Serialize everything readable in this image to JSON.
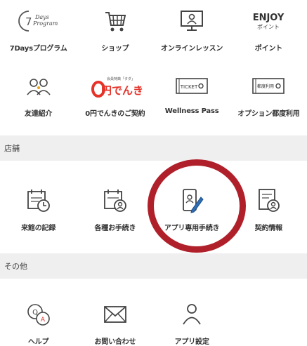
{
  "colors": {
    "accent": "#e5332a",
    "ring": "#b0202a",
    "section_bg": "#efefef",
    "text": "#333333"
  },
  "top_row": [
    {
      "label": "7Daysプログラム",
      "icon": "7days-program-logo",
      "logo_num": "7",
      "logo_l1": "Days",
      "logo_l2": "Program"
    },
    {
      "label": "ショップ",
      "icon": "shopping-cart-icon"
    },
    {
      "label": "オンラインレッスン",
      "icon": "monitor-person-icon"
    },
    {
      "label": "ポイント",
      "icon": "enjoy-point-logo",
      "logo_title": "ENJOY",
      "logo_sub": "ポイント"
    }
  ],
  "second_row": [
    {
      "label": "友達紹介",
      "icon": "two-people-icon"
    },
    {
      "label": "0円でんきのご契約",
      "icon": "zero-yen-denki-logo",
      "logo_small": "会員特典「タダ」",
      "logo_big": "円でんき"
    },
    {
      "label": "Wellness Pass",
      "icon": "ticket-icon",
      "ticket_text": "TICKET"
    },
    {
      "label": "オプション都度利用",
      "icon": "per-use-ticket-icon",
      "ticket_text": "都度利用"
    }
  ],
  "sections": {
    "store": "店舗",
    "other": "その他"
  },
  "store_row": [
    {
      "label": "来館の記録",
      "icon": "calendar-clock-icon"
    },
    {
      "label": "各種お手続き",
      "icon": "calendar-person-icon"
    },
    {
      "label": "アプリ専用手続き",
      "icon": "phone-pen-icon"
    },
    {
      "label": "契約情報",
      "icon": "document-person-icon"
    }
  ],
  "other_row": [
    {
      "label": "ヘルプ",
      "icon": "qa-bubbles-icon"
    },
    {
      "label": "お問い合わせ",
      "icon": "envelope-icon"
    },
    {
      "label": "アプリ設定",
      "icon": "user-settings-icon"
    }
  ]
}
